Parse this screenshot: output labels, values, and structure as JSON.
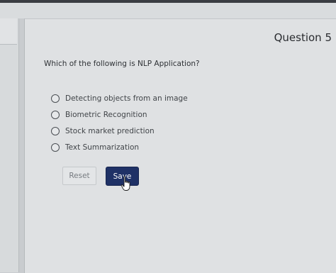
{
  "question": {
    "number_label": "Question 5",
    "text": "Which of the following is NLP Application?"
  },
  "options": [
    {
      "label": "Detecting objects from an image",
      "selected": false
    },
    {
      "label": "Biometric Recognition",
      "selected": false
    },
    {
      "label": "Stock market prediction",
      "selected": false
    },
    {
      "label": "Text Summarization",
      "selected": false
    }
  ],
  "buttons": {
    "reset_label": "Reset",
    "save_label": "Save"
  },
  "colors": {
    "save_button": "#1f3166",
    "background": "#dfe1e3"
  },
  "icons": {
    "cursor": "hand-pointer-icon"
  }
}
